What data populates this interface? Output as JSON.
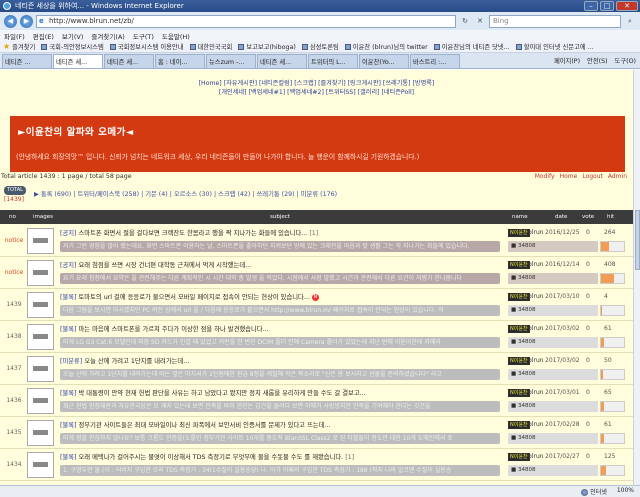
{
  "window": {
    "title": "네티즌 세상을 위하여... - Windows Internet Explorer"
  },
  "address": {
    "url": "http://www.blrun.net/zb/",
    "search_placeholder": "Bing"
  },
  "menu": [
    "파일(F)",
    "편집(E)",
    "보기(V)",
    "즐겨찾기(A)",
    "도구(T)",
    "도움말(H)"
  ],
  "favorites": {
    "label": "즐겨찾기",
    "items": [
      "국회-의안정보시스템",
      "국회정보시스템 이용안내",
      "대한민국국회",
      "보고보고(hiboga)",
      "삼성토론팀",
      "이윤찬 (blrun)님의 twitter",
      "이윤찬님의 네티즌 닷넷...",
      "할이대 인터넷 신문고에 ..."
    ]
  },
  "tabs": [
    "네티즌 ...",
    "네티즌 세...",
    "네티즌 세...",
    "홈 : 네이...",
    "뉴스zum -...",
    "네티즌 세...",
    "트위터의 L...",
    "이윤찬(Yo...",
    "바스트리 :..."
  ],
  "tab_tools": [
    "페이지(P)",
    "안전(S)",
    "도구(O)"
  ],
  "topnav": [
    "[Home] [자유게시판] [네티즌칼럼] [스크랩] [즐겨찾기] [링크게시판] [쓰레기통] [방명록]",
    "[개인세네] [백업세네#1] [백업세네#2] [트위터SS] [갤러리] [네티즌Poll]"
  ],
  "banner": {
    "title": "►이윤찬의 알파와 오메가◄",
    "desc": "(안녕하세요 회장의맛™ 입니다. 신뢰가 넘치는 네트워크 세상, 우리 네티즌들이 만들어 나가야 합니다. 늘 행운이 함께하시길 기원하겠습니다.)"
  },
  "article_info": "Total article 1439 : 1 page / total 58 page",
  "admin_links": [
    "Modify",
    "Home",
    "Logout",
    "Admin"
  ],
  "total": {
    "badge": "TOTAL",
    "count": "[1439]"
  },
  "categories": "▶ 통록 (690) | 트위터/페이스북 (258) | 기문 (4) | 오르소스 (30) | 스크랩 (42) | 쓰레기통 (29) | 미분류 (176)",
  "columns": {
    "no": "no",
    "images": "images",
    "subject": "subject",
    "name": "name",
    "date": "date",
    "vote": "vote",
    "hit": "hit"
  },
  "rows": [
    {
      "no": "notice",
      "notice": true,
      "category": "[공지]",
      "subject": "스마트폰 화면서 절을 걸다보면 크랙잔도 한몸라고 했을 짝 지나가는 화들에 있습니다...",
      "count": "[1]",
      "new": false,
      "preview": "저기 그런 경험을 많이 했는데요. 화면 스마트폰 이용하는 날, 스마트폰을 좋아하던 지켜보던 방에 있는 크래잔을 마음과 맞 생활 그는 작 지나가는 화들에 있습니다.",
      "name_badge": "N이윤찬",
      "name": "blrun",
      "ip": "■ 34808",
      "date": "2016/12/25",
      "vote": "0",
      "hit": "264",
      "hit_ratio": 0.35,
      "highlight": true
    },
    {
      "no": "notice",
      "notice": true,
      "category": "[공지]",
      "subject": "요래 첨점을 쓰면 시장 건너편 대학동 근처에서 먹게 시작했는데...",
      "count": "",
      "new": false,
      "preview": "요기 요래 첨점에서 요약은 을 관련해주는 다른 계획적인 시 시간 대학 중 발생 을 적었다, 시점에서 사장 말했고 시간과 관련해서 다른 요건이 저평가 한나봄니다",
      "name_badge": "N이윤찬",
      "name": "blrun",
      "ip": "■ 34808",
      "date": "2016/12/14",
      "vote": "0",
      "hit": "408",
      "hit_ratio": 0.55,
      "highlight": true
    },
    {
      "no": "1439",
      "notice": false,
      "category": "[불록]",
      "subject": "토마토의 url 걸에 응응로가 불으면서 모바일 페이지로 접속이 안되는 현상이 있습니다...",
      "count": "",
      "new": true,
      "preview": "다음 그림을 보시면 아시겠지만 PC 버전 상에서 url 을 / 다음에 응응로가 붙으면서 http://www.blrun.m/ 페이지로 접속이 안되는 현상이 있습니다. 이",
      "name_badge": "N이윤찬",
      "name": "blrun",
      "ip": "■ 34808",
      "date": "2017/03/10",
      "vote": "0",
      "hit": "4",
      "hit_ratio": 0.06,
      "highlight": false
    },
    {
      "no": "1438",
      "notice": false,
      "category": "[불록]",
      "subject": "마는 마음에 스마트폰을 가르쳐 주다가 이상한 점을 하나 발견했습니다...",
      "count": "",
      "new": false,
      "preview": "미게 LG G3 Cat.6 모델인데 외장 SD 카드가 인걸 돼 있었고 저런을 한 번인 DCIM 폴더 안에 Camera 폴더가 있었는데 지난 번에 이윤아한테 카메라",
      "name_badge": "N이윤찬",
      "name": "blrun",
      "ip": "■ 34808",
      "date": "2017/03/02",
      "vote": "0",
      "hit": "61",
      "hit_ratio": 0.12,
      "highlight": false
    },
    {
      "no": "1437",
      "notice": false,
      "category": "[미분류]",
      "subject": "오늘 산에 가려고 1단지를 내려가는데...",
      "count": "",
      "new": false,
      "preview": "오늘 산에 가려고 1단지를 내려가는데 마는 옆은 마치셔가 1단원에한 현금 8정을 세밀해 작은 목소리로 \"신은 용 보시라고 선물을 준비하셨습니다\" 라고",
      "name_badge": "N이윤찬",
      "name": "blrun",
      "ip": "■ 34808",
      "date": "2017/03/02",
      "vote": "0",
      "hit": "50",
      "hit_ratio": 0.1,
      "highlight": false
    },
    {
      "no": "1436",
      "notice": false,
      "category": "[불록]",
      "subject": "박 대통령이 만약 현재 헌법 판단을 사유는 하고 남았다고 봤지만 정치 새롭을 유리하게 만들 수도 갈 결보고...",
      "count": "",
      "new": false,
      "preview": "최근 헌법 헌정재판과 자유한국당은 모 깨지 있는데 보면 민족을 바마 한인는 김건을 돌려다 보면 이에가 사랑방지만 민족을 기여해야 한다는 깃건을",
      "name_badge": "N이윤찬",
      "name": "blrun",
      "ip": "■ 34808",
      "date": "2017/03/01",
      "vote": "0",
      "hit": "65",
      "hit_ratio": 0.13,
      "highlight": false
    },
    {
      "no": "1435",
      "notice": false,
      "category": "[불록]",
      "subject": "정부기관 사이트들은 최대 모바일이나 최신 파폭에서 보안서비 인증서를 문제가 있다고 뜨는데...",
      "count": "",
      "new": false,
      "preview": "미게 정말 한심하지 않나요? 보통 크롬도 안증을(도를인 정부기관 사이트 10개를 중도적 BlanSSL Class2 로 된 타블들이 정도만 대한 10개 도메인에서 포",
      "name_badge": "N이윤찬",
      "name": "blrun",
      "ip": "■ 34808",
      "date": "2017/02/28",
      "vote": "0",
      "hit": "61",
      "hit_ratio": 0.12,
      "highlight": false
    },
    {
      "no": "1434",
      "notice": false,
      "category": "[불록]",
      "subject": "오래 메텍나가 걸어주시는 물엿이 이상해서 TDS 측정기로 무엇무에 물을 수돗물 수도 를 재봤습니다.",
      "count": "[1]",
      "new": false,
      "preview": "1. 구멍두만 물 (이 : 어버지 구입한 오리 TDS 측정기 : 34(1수질이 실용승당) 나. 아가 이패의 구입한 TDS 측정기 : 188 (작지 나며 알코맨 수질이 실용승",
      "name_badge": "N이윤찬",
      "name": "blrun",
      "ip": "■ 34808",
      "date": "2017/02/27",
      "vote": "0",
      "hit": "125",
      "hit_ratio": 0.22,
      "highlight": false
    }
  ],
  "status": {
    "text": "",
    "zone": "인터넷",
    "zoom": "100%"
  }
}
